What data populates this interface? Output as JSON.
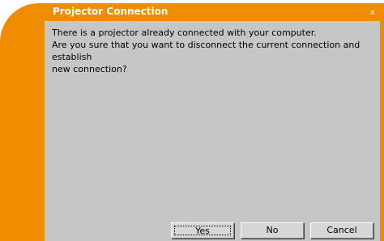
{
  "dialog": {
    "title": "Projector Connection",
    "close_label": "x",
    "message_lines": [
      "There is a projector already connected with your computer.",
      "Are you sure that you want to disconnect the current connection and establish",
      "new connection?"
    ],
    "buttons": {
      "yes": "Yes",
      "no": "No",
      "cancel": "Cancel"
    }
  },
  "colors": {
    "frame": "#f08c00",
    "panel": "#c6c6c6",
    "title_text": "#ffffff"
  }
}
